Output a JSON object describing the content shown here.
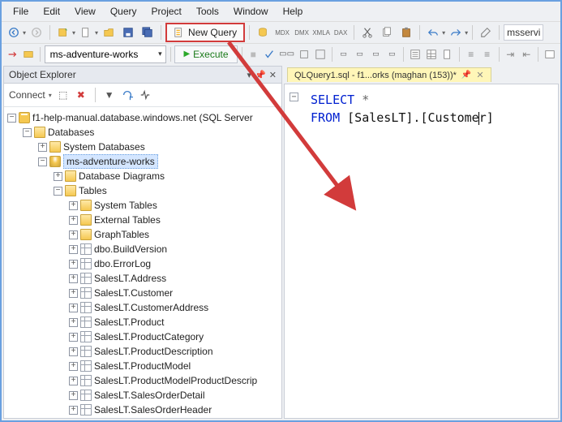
{
  "menu": {
    "items": [
      "File",
      "Edit",
      "View",
      "Query",
      "Project",
      "Tools",
      "Window",
      "Help"
    ]
  },
  "toolbar1": {
    "new_query_label": "New Query",
    "mssvc_label": "msservi"
  },
  "toolbar2": {
    "db_combo": "ms-adventure-works",
    "execute_label": "Execute"
  },
  "explorer": {
    "title": "Object Explorer",
    "connect_label": "Connect",
    "server": "f1-help-manual.database.windows.net (SQL Server ",
    "databases": "Databases",
    "sys_db": "System Databases",
    "sel_db": "ms-adventure-works",
    "diagrams": "Database Diagrams",
    "tables": "Tables",
    "sys_tables": "System Tables",
    "ext_tables": "External Tables",
    "graph_tables": "GraphTables",
    "items": [
      "dbo.BuildVersion",
      "dbo.ErrorLog",
      "SalesLT.Address",
      "SalesLT.Customer",
      "SalesLT.CustomerAddress",
      "SalesLT.Product",
      "SalesLT.ProductCategory",
      "SalesLT.ProductDescription",
      "SalesLT.ProductModel",
      "SalesLT.ProductModelProductDescrip",
      "SalesLT.SalesOrderDetail",
      "SalesLT.SalesOrderHeader"
    ]
  },
  "editor": {
    "tab_label": "QLQuery1.sql - f1...orks (maghan (153))*",
    "code": {
      "kw1": "SELECT",
      "star": " *",
      "kw2": "FROM",
      "ident": " [SalesLT].[Custome",
      "ident_tail": "r]"
    }
  }
}
